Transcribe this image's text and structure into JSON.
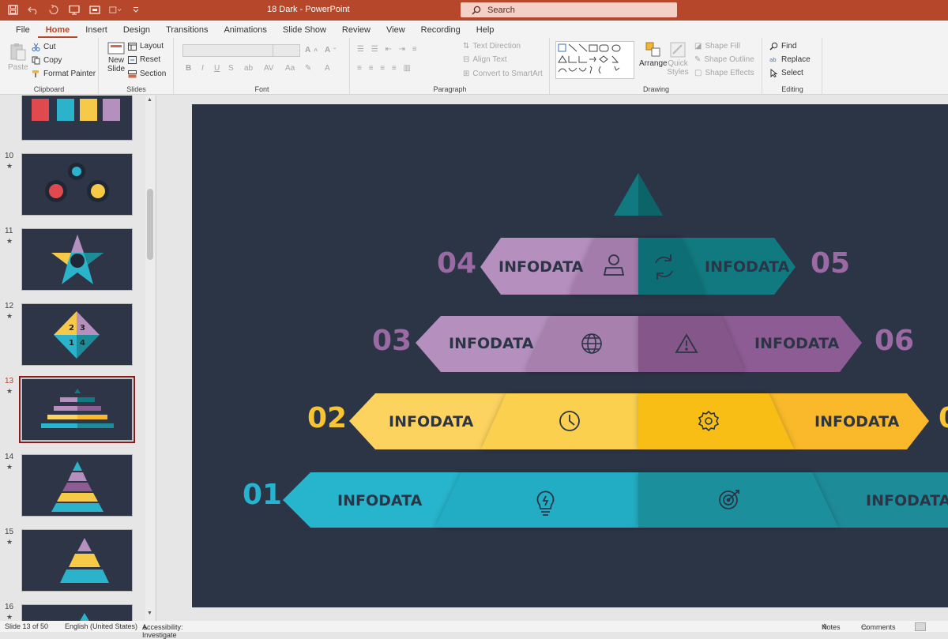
{
  "app": {
    "window_title": "18 Dark  -  PowerPoint",
    "search_placeholder": "Search"
  },
  "tabs": [
    "File",
    "Home",
    "Insert",
    "Design",
    "Transitions",
    "Animations",
    "Slide Show",
    "Review",
    "View",
    "Recording",
    "Help"
  ],
  "active_tab": "Home",
  "ribbon": {
    "clipboard": {
      "label": "Clipboard",
      "paste": "Paste",
      "cut": "Cut",
      "copy": "Copy",
      "format_painter": "Format Painter"
    },
    "slides": {
      "label": "Slides",
      "new_slide": "New Slide",
      "layout": "Layout",
      "reset": "Reset",
      "section": "Section"
    },
    "font": {
      "label": "Font"
    },
    "paragraph": {
      "label": "Paragraph",
      "text_direction": "Text Direction",
      "align_text": "Align Text",
      "convert_smartart": "Convert to SmartArt"
    },
    "drawing": {
      "label": "Drawing",
      "arrange": "Arrange",
      "quick_styles": "Quick Styles",
      "shape_fill": "Shape Fill",
      "shape_outline": "Shape Outline",
      "shape_effects": "Shape Effects"
    },
    "editing": {
      "label": "Editing",
      "find": "Find",
      "replace": "Replace",
      "select": "Select"
    }
  },
  "thumbnails": {
    "numbers": [
      "10",
      "11",
      "12",
      "13",
      "14",
      "15",
      "16"
    ],
    "selected": "13"
  },
  "slide": {
    "rows": [
      {
        "left_num": "04",
        "right_num": "05",
        "left_text": "INFODATA",
        "right_text": "INFODATA",
        "left_icon": "user-icon",
        "right_icon": "refresh-icon"
      },
      {
        "left_num": "03",
        "right_num": "06",
        "left_text": "INFODATA",
        "right_text": "INFODATA",
        "left_icon": "globe-icon",
        "right_icon": "warning-icon"
      },
      {
        "left_num": "02",
        "right_num": "0",
        "left_text": "INFODATA",
        "right_text": "INFODATA",
        "left_icon": "clock-icon",
        "right_icon": "gear-icon"
      },
      {
        "left_num": "01",
        "left_text": "INFODATA",
        "right_text": "INFODATA",
        "left_icon": "lightbulb-icon",
        "right_icon": "target-icon"
      }
    ],
    "colors": {
      "background": "#2c3546",
      "teal": "#117a80",
      "purple_light": "#b58fbd",
      "purple_dark": "#8d5c94",
      "yellow_light": "#fcd35e",
      "yellow_dark": "#f9b92a",
      "cyan_light": "#27b5cd",
      "cyan_dark": "#1e8b99",
      "num_purple": "#9b6aa4",
      "num_yellow": "#f9c431",
      "num_cyan": "#26b3cf"
    }
  },
  "status": {
    "slide_info": "Slide 13 of 50",
    "language": "English (United States)",
    "accessibility": "Accessibility: Investigate",
    "notes": "Notes",
    "comments": "Comments"
  }
}
